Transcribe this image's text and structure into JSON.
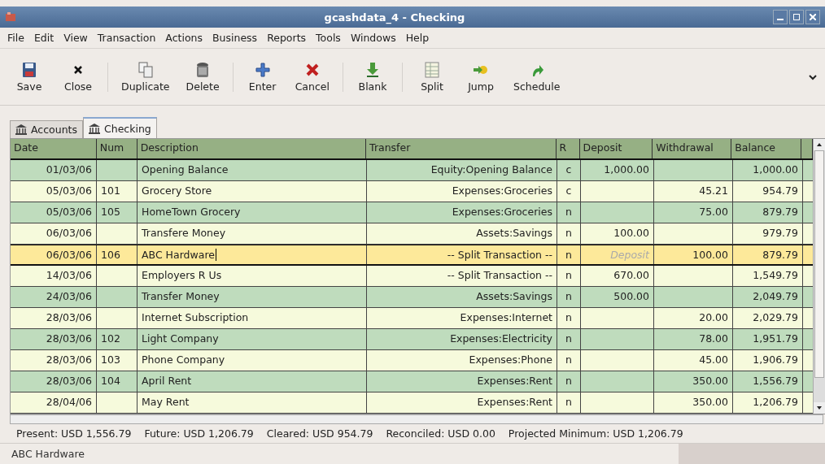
{
  "window": {
    "title": "gcashdata_4 - Checking"
  },
  "menu": [
    "File",
    "Edit",
    "View",
    "Transaction",
    "Actions",
    "Business",
    "Reports",
    "Tools",
    "Windows",
    "Help"
  ],
  "toolbar": [
    [
      {
        "kind": "save",
        "label": "Save"
      },
      {
        "kind": "close",
        "label": "Close"
      }
    ],
    [
      {
        "kind": "duplicate",
        "label": "Duplicate"
      },
      {
        "kind": "delete",
        "label": "Delete"
      }
    ],
    [
      {
        "kind": "enter",
        "label": "Enter"
      },
      {
        "kind": "cancel",
        "label": "Cancel"
      }
    ],
    [
      {
        "kind": "blank",
        "label": "Blank"
      }
    ],
    [
      {
        "kind": "split",
        "label": "Split"
      },
      {
        "kind": "jump",
        "label": "Jump"
      },
      {
        "kind": "schedule",
        "label": "Schedule"
      }
    ]
  ],
  "tabs": [
    {
      "label": "Accounts",
      "selected": false
    },
    {
      "label": "Checking",
      "selected": true
    }
  ],
  "table": {
    "columns": [
      "Date",
      "Num",
      "Description",
      "Transfer",
      "R",
      "Deposit",
      "Withdrawal",
      "Balance"
    ],
    "rows": [
      {
        "date": "01/03/06",
        "num": "",
        "description": "Opening Balance",
        "transfer": "Equity:Opening Balance",
        "r": "c",
        "deposit": "1,000.00",
        "withdrawal": "",
        "balance": "1,000.00",
        "selected": false
      },
      {
        "date": "05/03/06",
        "num": "101",
        "description": "Grocery Store",
        "transfer": "Expenses:Groceries",
        "r": "c",
        "deposit": "",
        "withdrawal": "45.21",
        "balance": "954.79",
        "selected": false
      },
      {
        "date": "05/03/06",
        "num": "105",
        "description": "HomeTown Grocery",
        "transfer": "Expenses:Groceries",
        "r": "n",
        "deposit": "",
        "withdrawal": "75.00",
        "balance": "879.79",
        "selected": false
      },
      {
        "date": "06/03/06",
        "num": "",
        "description": "Transfere Money",
        "transfer": "Assets:Savings",
        "r": "n",
        "deposit": "100.00",
        "withdrawal": "",
        "balance": "979.79",
        "selected": false
      },
      {
        "date": "06/03/06",
        "num": "106",
        "description": "ABC Hardware",
        "transfer": "-- Split Transaction --",
        "r": "n",
        "deposit": "",
        "deposit_placeholder": "Deposit",
        "withdrawal": "100.00",
        "balance": "879.79",
        "selected": true
      },
      {
        "date": "14/03/06",
        "num": "",
        "description": "Employers R Us",
        "transfer": "-- Split Transaction --",
        "r": "n",
        "deposit": "670.00",
        "withdrawal": "",
        "balance": "1,549.79",
        "selected": false
      },
      {
        "date": "24/03/06",
        "num": "",
        "description": "Transfer Money",
        "transfer": "Assets:Savings",
        "r": "n",
        "deposit": "500.00",
        "withdrawal": "",
        "balance": "2,049.79",
        "selected": false
      },
      {
        "date": "28/03/06",
        "num": "",
        "description": "Internet Subscription",
        "transfer": "Expenses:Internet",
        "r": "n",
        "deposit": "",
        "withdrawal": "20.00",
        "balance": "2,029.79",
        "selected": false
      },
      {
        "date": "28/03/06",
        "num": "102",
        "description": "Light Company",
        "transfer": "Expenses:Electricity",
        "r": "n",
        "deposit": "",
        "withdrawal": "78.00",
        "balance": "1,951.79",
        "selected": false
      },
      {
        "date": "28/03/06",
        "num": "103",
        "description": "Phone Company",
        "transfer": "Expenses:Phone",
        "r": "n",
        "deposit": "",
        "withdrawal": "45.00",
        "balance": "1,906.79",
        "selected": false
      },
      {
        "date": "28/03/06",
        "num": "104",
        "description": "April Rent",
        "transfer": "Expenses:Rent",
        "r": "n",
        "deposit": "",
        "withdrawal": "350.00",
        "balance": "1,556.79",
        "selected": false
      },
      {
        "date": "28/04/06",
        "num": "",
        "description": "May Rent",
        "transfer": "Expenses:Rent",
        "r": "n",
        "deposit": "",
        "withdrawal": "350.00",
        "balance": "1,206.79",
        "selected": false
      }
    ]
  },
  "summary": [
    "Present: USD 1,556.79",
    "Future: USD 1,206.79",
    "Cleared: USD 954.79",
    "Reconciled: USD 0.00",
    "Projected Minimum: USD 1,206.79"
  ],
  "status_bar": {
    "text": "ABC Hardware"
  }
}
